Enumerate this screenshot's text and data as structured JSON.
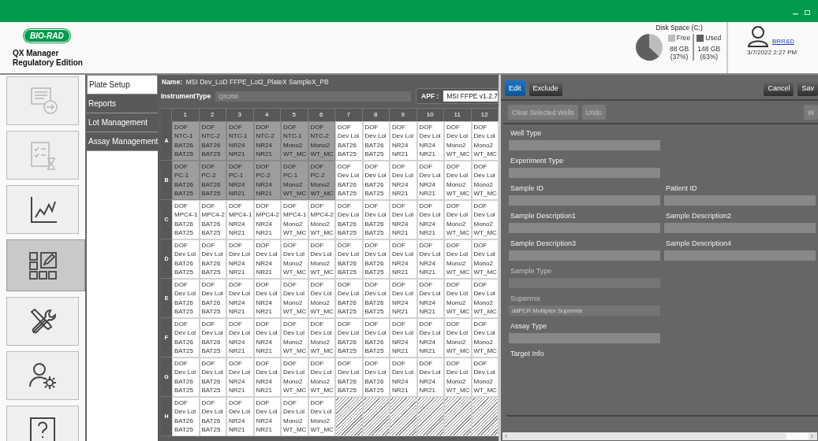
{
  "title_bar": {
    "buttons": [
      {
        "kind": "minimize"
      },
      {
        "kind": "maximize"
      }
    ]
  },
  "header": {
    "logo": "BIO-RAD",
    "product": "QX Manager",
    "edition": "Regulatory Edition"
  },
  "disk": {
    "title": "Disk Space (C:)",
    "chart_data": {
      "type": "pie",
      "categories": [
        "Free",
        "Used"
      ],
      "values": [
        37,
        63
      ]
    },
    "legend": [
      {
        "color": "#bdbdbd",
        "size": "88 GB",
        "percent": "(37%)"
      },
      {
        "color": "#5f5f5f",
        "size": "148 GB",
        "percent": "(63%)"
      }
    ]
  },
  "user": {
    "name": "BRR&D",
    "datetime": "3/7/2022 2:27 PM"
  },
  "rail": [
    {
      "kind": "import",
      "selected": false,
      "disabled": true
    },
    {
      "kind": "review",
      "selected": false,
      "disabled": true
    },
    {
      "kind": "analysis",
      "selected": false,
      "disabled": false
    },
    {
      "kind": "plate",
      "selected": true,
      "disabled": false
    },
    {
      "kind": "tools",
      "selected": false,
      "disabled": false
    },
    {
      "kind": "users",
      "selected": false,
      "disabled": false
    },
    {
      "kind": "help",
      "selected": false,
      "disabled": false
    }
  ],
  "nav": [
    {
      "label": "Plate Setup",
      "selected": true
    },
    {
      "label": "Reports",
      "selected": false
    },
    {
      "label": "Lot Management",
      "selected": false
    },
    {
      "label": "Assay Management",
      "selected": false
    }
  ],
  "plate": {
    "name_label": "Name:",
    "name": "MSI Dev_LoD FFPE_Lot2_PlateX SampleX_PB",
    "instrument_label": "InstrumentType",
    "instrument": "QX200",
    "apf_label": "APF :",
    "apf": "MSI FFPE v1.2.7",
    "columns": [
      "1",
      "2",
      "3",
      "4",
      "5",
      "6",
      "7",
      "8",
      "9",
      "10",
      "11",
      "12"
    ],
    "rows": [
      {
        "label": "A",
        "wells": [
          {
            "kind": "sample",
            "selected": true,
            "lines": [
              "DOF",
              "NTC-1",
              "BAT26",
              "BAT25"
            ]
          },
          {
            "kind": "sample",
            "selected": true,
            "lines": [
              "DOF",
              "NTC-2",
              "BAT26",
              "BAT25"
            ]
          },
          {
            "kind": "sample",
            "selected": true,
            "lines": [
              "DOF",
              "NTC-1",
              "NR24",
              "NR21"
            ]
          },
          {
            "kind": "sample",
            "selected": true,
            "lines": [
              "DOF",
              "NTC-2",
              "NR24",
              "NR21"
            ]
          },
          {
            "kind": "sample",
            "selected": true,
            "lines": [
              "DOF",
              "NTC-1",
              "Mono2",
              "WT_MC"
            ]
          },
          {
            "kind": "sample",
            "selected": true,
            "lines": [
              "DOF",
              "NTC-2",
              "Mono2",
              "WT_MC"
            ]
          },
          {
            "kind": "sample",
            "selected": false,
            "lines": [
              "DOF",
              "Dev Lol",
              "BAT26",
              "BAT25"
            ]
          },
          {
            "kind": "sample",
            "selected": false,
            "lines": [
              "DOF",
              "Dev Lol",
              "BAT26",
              "BAT25"
            ]
          },
          {
            "kind": "sample",
            "selected": false,
            "lines": [
              "DOF",
              "Dev Lol",
              "NR24",
              "NR21"
            ]
          },
          {
            "kind": "sample",
            "selected": false,
            "lines": [
              "DOF",
              "Dev Lol",
              "NR24",
              "NR21"
            ]
          },
          {
            "kind": "sample",
            "selected": false,
            "lines": [
              "DOF",
              "Dev Lol",
              "Mono2",
              "WT_MC"
            ]
          },
          {
            "kind": "sample",
            "selected": false,
            "lines": [
              "DOF",
              "Dev Lol",
              "Mono2",
              "WT_MC"
            ]
          }
        ]
      },
      {
        "label": "B",
        "wells": [
          {
            "kind": "sample",
            "selected": true,
            "lines": [
              "DOF",
              "PC-1",
              "BAT26",
              "BAT25"
            ]
          },
          {
            "kind": "sample",
            "selected": true,
            "lines": [
              "DOF",
              "PC-2",
              "BAT26",
              "BAT25"
            ]
          },
          {
            "kind": "sample",
            "selected": true,
            "lines": [
              "DOF",
              "PC-1",
              "NR24",
              "NR21"
            ]
          },
          {
            "kind": "sample",
            "selected": true,
            "lines": [
              "DOF",
              "PC-2",
              "NR24",
              "NR21"
            ]
          },
          {
            "kind": "sample",
            "selected": true,
            "lines": [
              "DOF",
              "PC-1",
              "Mono2",
              "WT_MC"
            ]
          },
          {
            "kind": "sample",
            "selected": true,
            "lines": [
              "DOF",
              "PC-2",
              "Mono2",
              "WT_MC"
            ]
          },
          {
            "kind": "sample",
            "selected": false,
            "lines": [
              "DOF",
              "Dev Lol",
              "BAT26",
              "BAT25"
            ]
          },
          {
            "kind": "sample",
            "selected": false,
            "lines": [
              "DOF",
              "Dev Lol",
              "BAT26",
              "BAT25"
            ]
          },
          {
            "kind": "sample",
            "selected": false,
            "lines": [
              "DOF",
              "Dev Lol",
              "NR24",
              "NR21"
            ]
          },
          {
            "kind": "sample",
            "selected": false,
            "lines": [
              "DOF",
              "Dev Lol",
              "NR24",
              "NR21"
            ]
          },
          {
            "kind": "sample",
            "selected": false,
            "lines": [
              "DOF",
              "Dev Lol",
              "Mono2",
              "WT_MC"
            ]
          },
          {
            "kind": "sample",
            "selected": false,
            "lines": [
              "DOF",
              "Dev Lol",
              "Mono2",
              "WT_MC"
            ]
          }
        ]
      },
      {
        "label": "C",
        "wells": [
          {
            "kind": "sample",
            "selected": false,
            "lines": [
              "DOF",
              "MPC4-1",
              "BAT26",
              "BAT25"
            ]
          },
          {
            "kind": "sample",
            "selected": false,
            "lines": [
              "DOF",
              "MPC4-2",
              "BAT26",
              "BAT25"
            ]
          },
          {
            "kind": "sample",
            "selected": false,
            "lines": [
              "DOF",
              "MPC4-1",
              "NR24",
              "NR21"
            ]
          },
          {
            "kind": "sample",
            "selected": false,
            "lines": [
              "DOF",
              "MPC4-2",
              "NR24",
              "NR21"
            ]
          },
          {
            "kind": "sample",
            "selected": false,
            "lines": [
              "DOF",
              "MPC4-1",
              "Mono2",
              "WT_MC"
            ]
          },
          {
            "kind": "sample",
            "selected": false,
            "lines": [
              "DOF",
              "MPC4-2",
              "Mono2",
              "WT_MC"
            ]
          },
          {
            "kind": "sample",
            "selected": false,
            "lines": [
              "DOF",
              "Dev Lol",
              "BAT26",
              "BAT25"
            ]
          },
          {
            "kind": "sample",
            "selected": false,
            "lines": [
              "DOF",
              "Dev Lol",
              "BAT26",
              "BAT25"
            ]
          },
          {
            "kind": "sample",
            "selected": false,
            "lines": [
              "DOF",
              "Dev Lol",
              "NR24",
              "NR21"
            ]
          },
          {
            "kind": "sample",
            "selected": false,
            "lines": [
              "DOF",
              "Dev Lol",
              "NR24",
              "NR21"
            ]
          },
          {
            "kind": "sample",
            "selected": false,
            "lines": [
              "DOF",
              "Dev Lol",
              "Mono2",
              "WT_MC"
            ]
          },
          {
            "kind": "sample",
            "selected": false,
            "lines": [
              "DOF",
              "Dev Lol",
              "Mono2",
              "WT_MC"
            ]
          }
        ]
      },
      {
        "label": "D",
        "wells": [
          {
            "kind": "sample",
            "selected": false,
            "lines": [
              "DOF",
              "Dev Lol",
              "BAT26",
              "BAT25"
            ]
          },
          {
            "kind": "sample",
            "selected": false,
            "lines": [
              "DOF",
              "Dev Lol",
              "BAT26",
              "BAT25"
            ]
          },
          {
            "kind": "sample",
            "selected": false,
            "lines": [
              "DOF",
              "Dev Lol",
              "NR24",
              "NR21"
            ]
          },
          {
            "kind": "sample",
            "selected": false,
            "lines": [
              "DOF",
              "Dev Lol",
              "NR24",
              "NR21"
            ]
          },
          {
            "kind": "sample",
            "selected": false,
            "lines": [
              "DOF",
              "Dev Lol",
              "Mono2",
              "WT_MC"
            ]
          },
          {
            "kind": "sample",
            "selected": false,
            "lines": [
              "DOF",
              "Dev Lol",
              "Mono2",
              "WT_MC"
            ]
          },
          {
            "kind": "sample",
            "selected": false,
            "lines": [
              "DOF",
              "Dev Lol",
              "BAT26",
              "BAT25"
            ]
          },
          {
            "kind": "sample",
            "selected": false,
            "lines": [
              "DOF",
              "Dev Lol",
              "BAT26",
              "BAT25"
            ]
          },
          {
            "kind": "sample",
            "selected": false,
            "lines": [
              "DOF",
              "Dev Lol",
              "NR24",
              "NR21"
            ]
          },
          {
            "kind": "sample",
            "selected": false,
            "lines": [
              "DOF",
              "Dev Lol",
              "NR24",
              "NR21"
            ]
          },
          {
            "kind": "sample",
            "selected": false,
            "lines": [
              "DOF",
              "Dev Lol",
              "Mono2",
              "WT_MC"
            ]
          },
          {
            "kind": "sample",
            "selected": false,
            "lines": [
              "DOF",
              "Dev Lol",
              "Mono2",
              "WT_MC"
            ]
          }
        ]
      },
      {
        "label": "E",
        "wells": [
          {
            "kind": "sample",
            "selected": false,
            "lines": [
              "DOF",
              "Dev Lol",
              "BAT26",
              "BAT25"
            ]
          },
          {
            "kind": "sample",
            "selected": false,
            "lines": [
              "DOF",
              "Dev Lol",
              "BAT26",
              "BAT25"
            ]
          },
          {
            "kind": "sample",
            "selected": false,
            "lines": [
              "DOF",
              "Dev Lol",
              "NR24",
              "NR21"
            ]
          },
          {
            "kind": "sample",
            "selected": false,
            "lines": [
              "DOF",
              "Dev Lol",
              "NR24",
              "NR21"
            ]
          },
          {
            "kind": "sample",
            "selected": false,
            "lines": [
              "DOF",
              "Dev Lol",
              "Mono2",
              "WT_MC"
            ]
          },
          {
            "kind": "sample",
            "selected": false,
            "lines": [
              "DOF",
              "Dev Lol",
              "Mono2",
              "WT_MC"
            ]
          },
          {
            "kind": "sample",
            "selected": false,
            "lines": [
              "DOF",
              "Dev Lol",
              "BAT26",
              "BAT25"
            ]
          },
          {
            "kind": "sample",
            "selected": false,
            "lines": [
              "DOF",
              "Dev Lol",
              "BAT26",
              "BAT25"
            ]
          },
          {
            "kind": "sample",
            "selected": false,
            "lines": [
              "DOF",
              "Dev Lol",
              "NR24",
              "NR21"
            ]
          },
          {
            "kind": "sample",
            "selected": false,
            "lines": [
              "DOF",
              "Dev Lol",
              "NR24",
              "NR21"
            ]
          },
          {
            "kind": "sample",
            "selected": false,
            "lines": [
              "DOF",
              "Dev Lol",
              "Mono2",
              "WT_MC"
            ]
          },
          {
            "kind": "sample",
            "selected": false,
            "lines": [
              "DOF",
              "Dev Lol",
              "Mono2",
              "WT_MC"
            ]
          }
        ]
      },
      {
        "label": "F",
        "wells": [
          {
            "kind": "sample",
            "selected": false,
            "lines": [
              "DOF",
              "Dev Lol",
              "BAT26",
              "BAT25"
            ]
          },
          {
            "kind": "sample",
            "selected": false,
            "lines": [
              "DOF",
              "Dev Lol",
              "BAT26",
              "BAT25"
            ]
          },
          {
            "kind": "sample",
            "selected": false,
            "lines": [
              "DOF",
              "Dev Lol",
              "NR24",
              "NR21"
            ]
          },
          {
            "kind": "sample",
            "selected": false,
            "lines": [
              "DOF",
              "Dev Lol",
              "NR24",
              "NR21"
            ]
          },
          {
            "kind": "sample",
            "selected": false,
            "lines": [
              "DOF",
              "Dev Lol",
              "Mono2",
              "WT_MC"
            ]
          },
          {
            "kind": "sample",
            "selected": false,
            "lines": [
              "DOF",
              "Dev Lol",
              "Mono2",
              "WT_MC"
            ]
          },
          {
            "kind": "sample",
            "selected": false,
            "lines": [
              "DOF",
              "Dev Lol",
              "BAT26",
              "BAT25"
            ]
          },
          {
            "kind": "sample",
            "selected": false,
            "lines": [
              "DOF",
              "Dev Lol",
              "BAT26",
              "BAT25"
            ]
          },
          {
            "kind": "sample",
            "selected": false,
            "lines": [
              "DOF",
              "Dev Lol",
              "NR24",
              "NR21"
            ]
          },
          {
            "kind": "sample",
            "selected": false,
            "lines": [
              "DOF",
              "Dev Lol",
              "NR24",
              "NR21"
            ]
          },
          {
            "kind": "sample",
            "selected": false,
            "lines": [
              "DOF",
              "Dev Lol",
              "Mono2",
              "WT_MC"
            ]
          },
          {
            "kind": "sample",
            "selected": false,
            "lines": [
              "DOF",
              "Dev Lol",
              "Mono2",
              "WT_MC"
            ]
          }
        ]
      },
      {
        "label": "G",
        "wells": [
          {
            "kind": "sample",
            "selected": false,
            "lines": [
              "DOF",
              "Dev Lol",
              "BAT26",
              "BAT25"
            ]
          },
          {
            "kind": "sample",
            "selected": false,
            "lines": [
              "DOF",
              "Dev Lol",
              "BAT26",
              "BAT25"
            ]
          },
          {
            "kind": "sample",
            "selected": false,
            "lines": [
              "DOF",
              "Dev Lol",
              "NR24",
              "NR21"
            ]
          },
          {
            "kind": "sample",
            "selected": false,
            "lines": [
              "DOF",
              "Dev Lol",
              "NR24",
              "NR21"
            ]
          },
          {
            "kind": "sample",
            "selected": false,
            "lines": [
              "DOF",
              "Dev Lol",
              "Mono2",
              "WT_MC"
            ]
          },
          {
            "kind": "sample",
            "selected": false,
            "lines": [
              "DOF",
              "Dev Lol",
              "Mono2",
              "WT_MC"
            ]
          },
          {
            "kind": "sample",
            "selected": false,
            "lines": [
              "DOF",
              "Dev Lol",
              "BAT26",
              "BAT25"
            ]
          },
          {
            "kind": "sample",
            "selected": false,
            "lines": [
              "DOF",
              "Dev Lol",
              "BAT26",
              "BAT25"
            ]
          },
          {
            "kind": "sample",
            "selected": false,
            "lines": [
              "DOF",
              "Dev Lol",
              "NR24",
              "NR21"
            ]
          },
          {
            "kind": "sample",
            "selected": false,
            "lines": [
              "DOF",
              "Dev Lol",
              "NR24",
              "NR21"
            ]
          },
          {
            "kind": "sample",
            "selected": false,
            "lines": [
              "DOF",
              "Dev Lol",
              "Mono2",
              "WT_MC"
            ]
          },
          {
            "kind": "sample",
            "selected": false,
            "lines": [
              "DOF",
              "Dev Lol",
              "Mono2",
              "WT_MC"
            ]
          }
        ]
      },
      {
        "label": "H",
        "wells": [
          {
            "kind": "sample",
            "selected": false,
            "lines": [
              "DOF",
              "Dev Lol",
              "BAT26",
              "BAT25"
            ]
          },
          {
            "kind": "sample",
            "selected": false,
            "lines": [
              "DOF",
              "Dev Lol",
              "BAT26",
              "BAT25"
            ]
          },
          {
            "kind": "sample",
            "selected": false,
            "lines": [
              "DOF",
              "Dev Lol",
              "NR24",
              "NR21"
            ]
          },
          {
            "kind": "sample",
            "selected": false,
            "lines": [
              "DOF",
              "Dev Lol",
              "NR24",
              "NR21"
            ]
          },
          {
            "kind": "sample",
            "selected": false,
            "lines": [
              "DOF",
              "Dev Lol",
              "Mono2",
              "WT_MC"
            ]
          },
          {
            "kind": "sample",
            "selected": false,
            "lines": [
              "DOF",
              "Dev Lol",
              "Mono2",
              "WT_MC"
            ]
          },
          {
            "kind": "empty"
          },
          {
            "kind": "empty"
          },
          {
            "kind": "empty"
          },
          {
            "kind": "empty"
          },
          {
            "kind": "empty"
          },
          {
            "kind": "empty"
          }
        ]
      }
    ]
  },
  "panel": {
    "toolbar": [
      {
        "label": "Edit",
        "selected": true
      },
      {
        "label": "Exclude",
        "selected": false
      }
    ],
    "actions": [
      "Cancel",
      "Sav"
    ],
    "tools": [
      {
        "label": "Clear Selected Wells",
        "disabled": true
      },
      {
        "label": "Undo",
        "disabled": true
      }
    ],
    "tools_right": [
      {
        "label": "W",
        "disabled": true
      }
    ],
    "form": [
      {
        "fields": [
          {
            "kind": "input",
            "label": "Well Type",
            "disabled": false
          }
        ]
      },
      {
        "fields": [
          {
            "kind": "input",
            "label": "Experiment Type",
            "disabled": false
          }
        ]
      },
      {
        "fields": [
          {
            "kind": "input",
            "label": "Sample ID",
            "disabled": false
          },
          {
            "kind": "input",
            "label": "Patient ID",
            "disabled": false
          }
        ]
      },
      {
        "fields": [
          {
            "kind": "input",
            "label": "Sample Description1",
            "disabled": false
          },
          {
            "kind": "input",
            "label": "Sample Description2",
            "disabled": false
          }
        ]
      },
      {
        "fields": [
          {
            "kind": "input",
            "label": "Sample Description3",
            "disabled": false
          },
          {
            "kind": "input",
            "label": "Sample Description4",
            "disabled": false
          }
        ]
      },
      {
        "fields": [
          {
            "kind": "input",
            "label": "Sample Type",
            "disabled": true
          }
        ]
      },
      {
        "fields": [
          {
            "kind": "input",
            "label": "Supermix",
            "disabled": true,
            "value": "ddPCR Multiplex Supermix"
          }
        ]
      },
      {
        "fields": [
          {
            "kind": "input",
            "label": "Assay Type",
            "disabled": false
          }
        ]
      },
      {
        "fields": [
          {
            "kind": "label",
            "label": "Target Info",
            "disabled": false
          }
        ]
      }
    ]
  }
}
